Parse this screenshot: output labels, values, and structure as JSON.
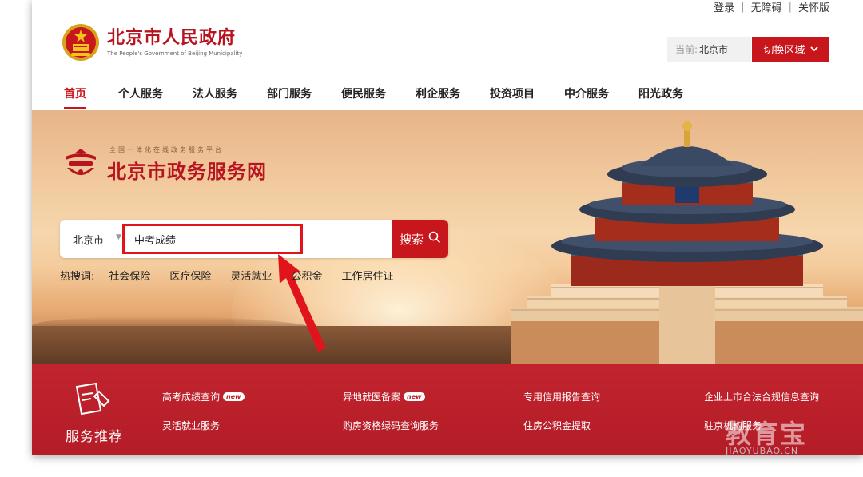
{
  "top_links": {
    "login": "登录",
    "sep1": "|",
    "accessibility": "无障碍",
    "sep2": "|",
    "care": "关怀版"
  },
  "header": {
    "title": "北京市人民政府",
    "subtitle": "The People's Government of Beijing Municipality",
    "region_label": "当前:",
    "region_value": "北京市",
    "switch_label": "切换区域"
  },
  "nav": {
    "items": [
      "首页",
      "个人服务",
      "法人服务",
      "部门服务",
      "便民服务",
      "利企服务",
      "投资项目",
      "中介服务",
      "阳光政务"
    ],
    "active_index": 0
  },
  "platform": {
    "small_text": "全国一体化在线政务服务平台",
    "title": "北京市政务服务网"
  },
  "search": {
    "city": "北京市",
    "query": "中考成绩",
    "button_label": "搜索"
  },
  "hot": {
    "label": "热搜词:",
    "terms": [
      "社会保险",
      "医疗保险",
      "灵活就业",
      "公积金",
      "工作居住证"
    ]
  },
  "services": {
    "title": "服务推荐",
    "badge": "new",
    "links": [
      "高考成绩查询",
      "异地就医备案",
      "专用信用报告查询",
      "企业上市合法合规信息查询",
      "灵活就业服务",
      "购房资格绿码查询服务",
      "住房公积金提取",
      "驻京机构服务"
    ]
  },
  "watermark": {
    "title": "教育宝",
    "sub": "JIAOYUBAO.CN"
  },
  "colors": {
    "brand_red": "#c8161d",
    "band_red": "#b41c27"
  }
}
